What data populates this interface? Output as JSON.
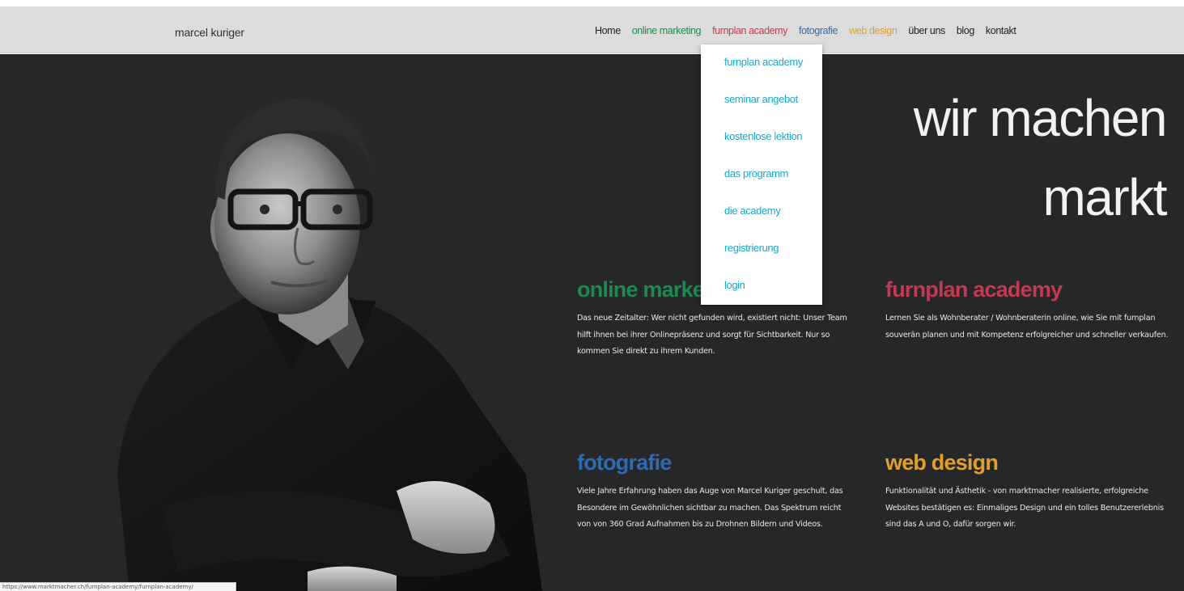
{
  "brand": "marcel kuriger",
  "nav": [
    {
      "label": "Home",
      "color": "#222222"
    },
    {
      "label": "online marketing",
      "color": "#1f8a4c"
    },
    {
      "label": "furnplan academy",
      "color": "#c23a4e"
    },
    {
      "label": "fotografie",
      "color": "#2f6bb3"
    },
    {
      "label": "web design",
      "color": "#e0a030"
    },
    {
      "label": "über uns",
      "color": "#222222"
    },
    {
      "label": "blog",
      "color": "#222222"
    },
    {
      "label": "kontakt",
      "color": "#222222"
    }
  ],
  "dropdown": {
    "color": "#1aa8c9",
    "items": [
      "furnplan academy",
      "seminar angebot",
      "kostenlose lektion",
      "das programm",
      "die academy",
      "registrierung",
      "login"
    ]
  },
  "headline": {
    "line1": "wir machen",
    "line2": "markt"
  },
  "blocks": [
    {
      "title": "online marketing",
      "color": "#1f8a4c",
      "text": "Das neue Zeitalter: Wer nicht gefunden wird, existiert nicht: Unser Team hilft ihnen bei ihrer Onlinepräsenz und sorgt für Sichtbarkeit. Nur so kommen Sie direkt zu ihrem Kunden."
    },
    {
      "title": "furnplan academy",
      "color": "#c23a4e",
      "text": "Lernen Sie als Wohnberater / Wohnberaterin online, wie Sie mit furnplan souverän planen und mit Kompetenz erfolgreicher und schneller verkaufen."
    },
    {
      "title": "fotografie",
      "color": "#2f6bb3",
      "text": "Viele Jahre Erfahrung haben das Auge von Marcel Kuriger geschult, das Besondere im Gewöhnlichen sichtbar zu machen. Das Spektrum reicht von von 360 Grad Aufnahmen bis zu Drohnen Bildern und Videos."
    },
    {
      "title": "web design",
      "color": "#e0a030",
      "text": "Funktionalität und Ästhetik -  von marktmacher realisierte, erfolgreiche Websites bestätigen es: Einmaliges Design und ein tolles Benutzererlebnis sind das A und O, dafür sorgen wir."
    }
  ],
  "statusbar": "https://www.marktmacher.ch/furnplan-academy/furnplan-academy/"
}
